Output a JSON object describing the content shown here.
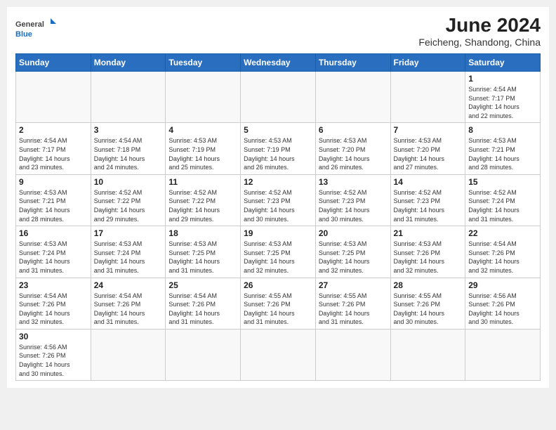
{
  "header": {
    "logo_general": "General",
    "logo_blue": "Blue",
    "title": "June 2024",
    "subtitle": "Feicheng, Shandong, China"
  },
  "days_of_week": [
    "Sunday",
    "Monday",
    "Tuesday",
    "Wednesday",
    "Thursday",
    "Friday",
    "Saturday"
  ],
  "weeks": [
    [
      {
        "day": "",
        "info": ""
      },
      {
        "day": "",
        "info": ""
      },
      {
        "day": "",
        "info": ""
      },
      {
        "day": "",
        "info": ""
      },
      {
        "day": "",
        "info": ""
      },
      {
        "day": "",
        "info": ""
      },
      {
        "day": "1",
        "info": "Sunrise: 4:54 AM\nSunset: 7:17 PM\nDaylight: 14 hours\nand 22 minutes."
      }
    ],
    [
      {
        "day": "2",
        "info": "Sunrise: 4:54 AM\nSunset: 7:17 PM\nDaylight: 14 hours\nand 23 minutes."
      },
      {
        "day": "3",
        "info": "Sunrise: 4:54 AM\nSunset: 7:18 PM\nDaylight: 14 hours\nand 24 minutes."
      },
      {
        "day": "4",
        "info": "Sunrise: 4:53 AM\nSunset: 7:19 PM\nDaylight: 14 hours\nand 25 minutes."
      },
      {
        "day": "5",
        "info": "Sunrise: 4:53 AM\nSunset: 7:19 PM\nDaylight: 14 hours\nand 26 minutes."
      },
      {
        "day": "6",
        "info": "Sunrise: 4:53 AM\nSunset: 7:20 PM\nDaylight: 14 hours\nand 26 minutes."
      },
      {
        "day": "7",
        "info": "Sunrise: 4:53 AM\nSunset: 7:20 PM\nDaylight: 14 hours\nand 27 minutes."
      },
      {
        "day": "8",
        "info": "Sunrise: 4:53 AM\nSunset: 7:21 PM\nDaylight: 14 hours\nand 28 minutes."
      }
    ],
    [
      {
        "day": "9",
        "info": "Sunrise: 4:53 AM\nSunset: 7:21 PM\nDaylight: 14 hours\nand 28 minutes."
      },
      {
        "day": "10",
        "info": "Sunrise: 4:52 AM\nSunset: 7:22 PM\nDaylight: 14 hours\nand 29 minutes."
      },
      {
        "day": "11",
        "info": "Sunrise: 4:52 AM\nSunset: 7:22 PM\nDaylight: 14 hours\nand 29 minutes."
      },
      {
        "day": "12",
        "info": "Sunrise: 4:52 AM\nSunset: 7:23 PM\nDaylight: 14 hours\nand 30 minutes."
      },
      {
        "day": "13",
        "info": "Sunrise: 4:52 AM\nSunset: 7:23 PM\nDaylight: 14 hours\nand 30 minutes."
      },
      {
        "day": "14",
        "info": "Sunrise: 4:52 AM\nSunset: 7:23 PM\nDaylight: 14 hours\nand 31 minutes."
      },
      {
        "day": "15",
        "info": "Sunrise: 4:52 AM\nSunset: 7:24 PM\nDaylight: 14 hours\nand 31 minutes."
      }
    ],
    [
      {
        "day": "16",
        "info": "Sunrise: 4:53 AM\nSunset: 7:24 PM\nDaylight: 14 hours\nand 31 minutes."
      },
      {
        "day": "17",
        "info": "Sunrise: 4:53 AM\nSunset: 7:24 PM\nDaylight: 14 hours\nand 31 minutes."
      },
      {
        "day": "18",
        "info": "Sunrise: 4:53 AM\nSunset: 7:25 PM\nDaylight: 14 hours\nand 31 minutes."
      },
      {
        "day": "19",
        "info": "Sunrise: 4:53 AM\nSunset: 7:25 PM\nDaylight: 14 hours\nand 32 minutes."
      },
      {
        "day": "20",
        "info": "Sunrise: 4:53 AM\nSunset: 7:25 PM\nDaylight: 14 hours\nand 32 minutes."
      },
      {
        "day": "21",
        "info": "Sunrise: 4:53 AM\nSunset: 7:26 PM\nDaylight: 14 hours\nand 32 minutes."
      },
      {
        "day": "22",
        "info": "Sunrise: 4:54 AM\nSunset: 7:26 PM\nDaylight: 14 hours\nand 32 minutes."
      }
    ],
    [
      {
        "day": "23",
        "info": "Sunrise: 4:54 AM\nSunset: 7:26 PM\nDaylight: 14 hours\nand 32 minutes."
      },
      {
        "day": "24",
        "info": "Sunrise: 4:54 AM\nSunset: 7:26 PM\nDaylight: 14 hours\nand 31 minutes."
      },
      {
        "day": "25",
        "info": "Sunrise: 4:54 AM\nSunset: 7:26 PM\nDaylight: 14 hours\nand 31 minutes."
      },
      {
        "day": "26",
        "info": "Sunrise: 4:55 AM\nSunset: 7:26 PM\nDaylight: 14 hours\nand 31 minutes."
      },
      {
        "day": "27",
        "info": "Sunrise: 4:55 AM\nSunset: 7:26 PM\nDaylight: 14 hours\nand 31 minutes."
      },
      {
        "day": "28",
        "info": "Sunrise: 4:55 AM\nSunset: 7:26 PM\nDaylight: 14 hours\nand 30 minutes."
      },
      {
        "day": "29",
        "info": "Sunrise: 4:56 AM\nSunset: 7:26 PM\nDaylight: 14 hours\nand 30 minutes."
      }
    ],
    [
      {
        "day": "30",
        "info": "Sunrise: 4:56 AM\nSunset: 7:26 PM\nDaylight: 14 hours\nand 30 minutes."
      },
      {
        "day": "",
        "info": ""
      },
      {
        "day": "",
        "info": ""
      },
      {
        "day": "",
        "info": ""
      },
      {
        "day": "",
        "info": ""
      },
      {
        "day": "",
        "info": ""
      },
      {
        "day": "",
        "info": ""
      }
    ]
  ]
}
